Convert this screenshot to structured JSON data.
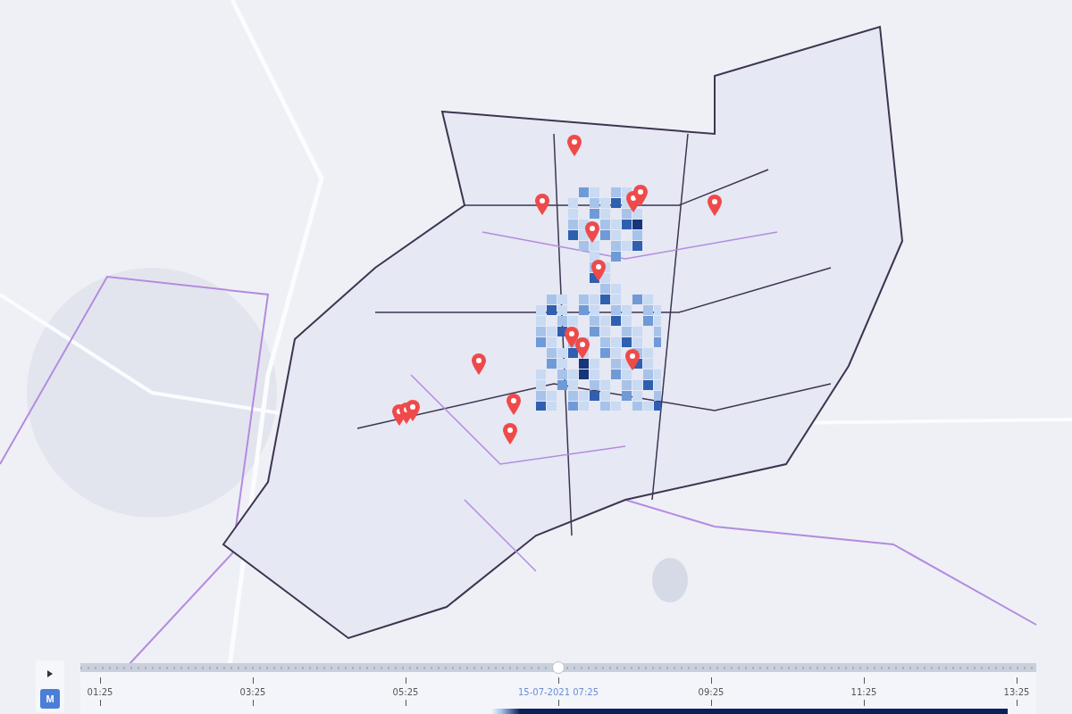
{
  "controls": {
    "mode_button": "M"
  },
  "timeline": {
    "level": 0.5,
    "ticks": [
      {
        "label": "01:25",
        "selected": false
      },
      {
        "label": "03:25",
        "selected": false
      },
      {
        "label": "05:25",
        "selected": false
      },
      {
        "label": "15-07-2021 07:25",
        "selected": true
      },
      {
        "label": "09:25",
        "selected": false
      },
      {
        "label": "11:25",
        "selected": false
      },
      {
        "label": "13:25",
        "selected": false
      }
    ]
  }
}
